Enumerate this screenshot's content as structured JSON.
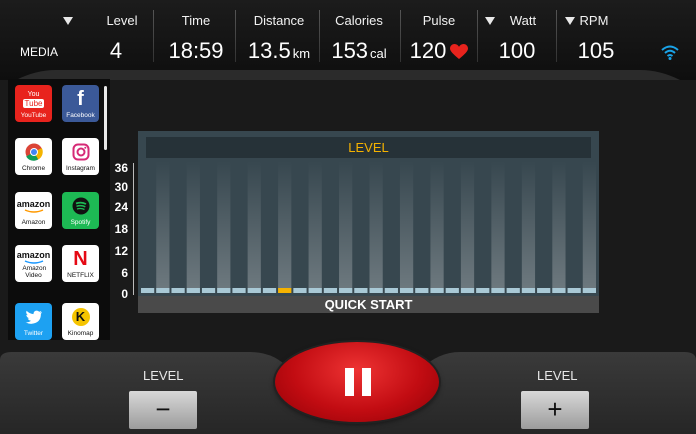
{
  "header": {
    "media_label": "MEDIA",
    "stats": [
      {
        "label": "Level",
        "value": "4",
        "unit": "",
        "dropdown": true
      },
      {
        "label": "Time",
        "value": "18:59",
        "unit": "",
        "dropdown": false
      },
      {
        "label": "Distance",
        "value": "13.5",
        "unit": "km",
        "dropdown": false
      },
      {
        "label": "Calories",
        "value": "153",
        "unit": "cal",
        "dropdown": false
      },
      {
        "label": "Pulse",
        "value": "120",
        "unit": "",
        "dropdown": false,
        "icon": "heart-icon"
      },
      {
        "label": "Watt",
        "value": "100",
        "unit": "",
        "dropdown": true
      },
      {
        "label": "RPM",
        "value": "105",
        "unit": "",
        "dropdown": true
      }
    ],
    "wifi_icon": "wifi-icon"
  },
  "apps": [
    {
      "name": "YouTube",
      "icon": "youtube-icon",
      "color": "#e8231d"
    },
    {
      "name": "Facebook",
      "icon": "facebook-icon",
      "color": "#3b5998"
    },
    {
      "name": "Chrome",
      "icon": "chrome-icon",
      "color": "#ffffff"
    },
    {
      "name": "Instagram",
      "icon": "instagram-icon",
      "color": "#ffffff"
    },
    {
      "name": "Amazon",
      "icon": "amazon-icon",
      "color": "#ffffff"
    },
    {
      "name": "Spotify",
      "icon": "spotify-icon",
      "color": "#1db954"
    },
    {
      "name": "Amazon Video",
      "icon": "amazon-video-icon",
      "color": "#ffffff"
    },
    {
      "name": "NETFLIX",
      "icon": "netflix-icon",
      "color": "#ffffff"
    },
    {
      "name": "Twitter",
      "icon": "twitter-icon",
      "color": "#1da1f2"
    },
    {
      "name": "Kinomap",
      "icon": "kinomap-icon",
      "color": "#ffffff"
    }
  ],
  "app_glyphs": {
    "youtube_top": "You",
    "youtube_bottom": "Tube",
    "facebook": "f",
    "amazon": "amazon",
    "amazon_video": "amazon",
    "netflix": "N",
    "kinomap": "K"
  },
  "chart_data": {
    "type": "bar",
    "title": "LEVEL",
    "footer_label": "QUICK START",
    "yticks": [
      "36",
      "30",
      "24",
      "18",
      "12",
      "6",
      "0"
    ],
    "ylim": [
      0,
      36
    ],
    "segment_count": 30,
    "values": [
      0,
      0,
      0,
      0,
      0,
      0,
      0,
      0,
      0,
      0,
      0,
      0,
      0,
      0,
      0,
      0,
      0,
      0,
      0,
      0,
      0,
      0,
      0,
      0,
      0,
      0,
      0,
      0,
      0,
      0
    ],
    "current_segment": 9,
    "colors": {
      "segment": "#a9c9d6",
      "current": "#f5b200",
      "background": "#37474f",
      "title": "#f5b200"
    }
  },
  "controls": {
    "level_label_left": "LEVEL",
    "level_label_right": "LEVEL",
    "decrease_label": "−",
    "increase_label": "+"
  },
  "colors": {
    "pause_button": "#c20c12",
    "heart": "#e8231d",
    "wifi": "#1aa3e8"
  }
}
